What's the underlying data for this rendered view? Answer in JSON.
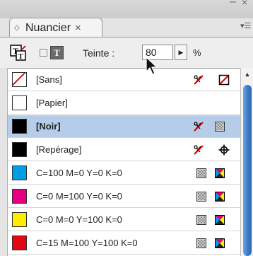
{
  "panel": {
    "tab_label": "Nuancier",
    "tab_close": "×",
    "window_min": "–",
    "window_close": "×"
  },
  "toolbar": {
    "teinte_label": "Teinte :",
    "teinte_value": "80",
    "percent": "%"
  },
  "icons": {
    "fill_stroke": "fill-stroke-swap-icon",
    "text_mode": "T",
    "non_print": "scissors-x-icon",
    "registration": "registration-mark-icon",
    "process": "process-color-icon",
    "cmyk": "cmyk-icon",
    "none_swatch": "none-slash-icon"
  },
  "swatches": [
    {
      "label": "[Sans]",
      "color": "#ffffff",
      "none": true,
      "locked": true,
      "mode": "none"
    },
    {
      "label": "[Papier]",
      "color": "#ffffff",
      "none": false,
      "locked": false,
      "mode": ""
    },
    {
      "label": "[Noir]",
      "color": "#000000",
      "none": false,
      "locked": true,
      "mode": "process",
      "selected": true
    },
    {
      "label": "[Repérage]",
      "color": "#000000",
      "none": false,
      "locked": true,
      "mode": "registration"
    },
    {
      "label": "C=100 M=0 Y=0 K=0",
      "color": "#009fe3",
      "none": false,
      "locked": false,
      "mode": "cmyk"
    },
    {
      "label": "C=0 M=100 Y=0 K=0",
      "color": "#e6007e",
      "none": false,
      "locked": false,
      "mode": "cmyk"
    },
    {
      "label": "C=0 M=0 Y=100 K=0",
      "color": "#ffed00",
      "none": false,
      "locked": false,
      "mode": "cmyk"
    },
    {
      "label": "C=15 M=100 Y=100 K=0",
      "color": "#e30613",
      "none": false,
      "locked": false,
      "mode": "cmyk"
    }
  ]
}
